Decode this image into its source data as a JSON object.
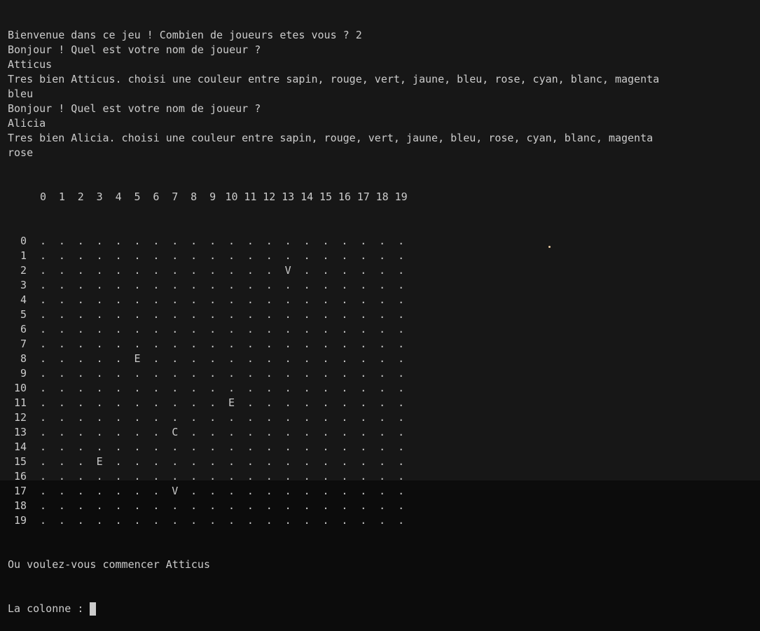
{
  "terminal": {
    "lines": [
      "Bienvenue dans ce jeu ! Combien de joueurs etes vous ? 2",
      "Bonjour ! Quel est votre nom de joueur ?",
      "Atticus",
      "Tres bien Atticus. choisi une couleur entre sapin, rouge, vert, jaune, bleu, rose, cyan, blanc, magenta",
      "bleu",
      "Bonjour ! Quel est votre nom de joueur ?",
      "Alicia",
      "Tres bien Alicia. choisi une couleur entre sapin, rouge, vert, jaune, bleu, rose, cyan, blanc, magenta",
      "rose"
    ],
    "grid": {
      "columns": [
        "0",
        "1",
        "2",
        "3",
        "4",
        "5",
        "6",
        "7",
        "8",
        "9",
        "10",
        "11",
        "12",
        "13",
        "14",
        "15",
        "16",
        "17",
        "18",
        "19"
      ],
      "rows": [
        "0",
        "1",
        "2",
        "3",
        "4",
        "5",
        "6",
        "7",
        "8",
        "9",
        "10",
        "11",
        "12",
        "13",
        "14",
        "15",
        "16",
        "17",
        "18",
        "19"
      ],
      "empty_symbol": ".",
      "pieces": [
        {
          "row": 2,
          "col": 13,
          "symbol": "V"
        },
        {
          "row": 8,
          "col": 5,
          "symbol": "E"
        },
        {
          "row": 11,
          "col": 10,
          "symbol": "E"
        },
        {
          "row": 13,
          "col": 7,
          "symbol": "C"
        },
        {
          "row": 15,
          "col": 3,
          "symbol": "E"
        },
        {
          "row": 17,
          "col": 7,
          "symbol": "V"
        }
      ]
    },
    "after_lines": [
      "Ou voulez-vous commencer Atticus"
    ],
    "input_prompt": "La colonne : ",
    "input_value": ""
  }
}
